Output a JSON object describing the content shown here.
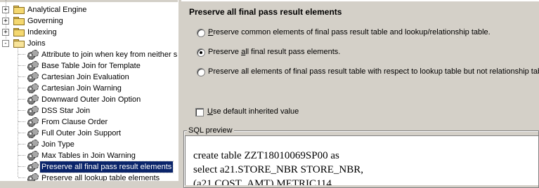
{
  "tree": {
    "items": [
      {
        "label": "Analytical Engine",
        "type": "folder",
        "expander": "+"
      },
      {
        "label": "Governing",
        "type": "folder",
        "expander": "+"
      },
      {
        "label": "Indexing",
        "type": "folder",
        "expander": "+"
      },
      {
        "label": "Joins",
        "type": "folder-open",
        "expander": "-"
      },
      {
        "label": "Attribute to join when key from neither s",
        "type": "setting"
      },
      {
        "label": "Base Table Join for Template",
        "type": "setting"
      },
      {
        "label": "Cartesian Join Evaluation",
        "type": "setting"
      },
      {
        "label": "Cartesian Join Warning",
        "type": "setting"
      },
      {
        "label": "Downward Outer Join Option",
        "type": "setting"
      },
      {
        "label": "DSS Star Join",
        "type": "setting"
      },
      {
        "label": "From Clause Order",
        "type": "setting"
      },
      {
        "label": "Full Outer Join Support",
        "type": "setting"
      },
      {
        "label": "Join Type",
        "type": "setting"
      },
      {
        "label": "Max Tables in Join Warning",
        "type": "setting"
      },
      {
        "label": "Preserve all final pass result elements",
        "type": "setting",
        "selected": true
      },
      {
        "label": "Preserve all lookup table elements",
        "type": "setting"
      }
    ]
  },
  "panel": {
    "title": "Preserve all final pass result elements",
    "options": [
      {
        "underline": "P",
        "rest": "reserve common elements of final pass result table and lookup/relationship table.",
        "selected": false
      },
      {
        "pre": "Preserve ",
        "underline": "a",
        "rest": "ll final result pass elements.",
        "selected": true
      },
      {
        "pre": "Preserve all elements of final pass result table with respect to lookup table but not relationship table.",
        "underline": "",
        "rest": "",
        "selected": false
      }
    ],
    "default_checkbox": {
      "underline": "U",
      "rest": "se default inherited value",
      "checked": false
    }
  },
  "sql": {
    "legend": "SQL preview",
    "lines": [
      "create table ZZT18010069SP00 as",
      "select a21.STORE_NBR  STORE_NBR,",
      "       (a21.COST_AMT)  METRIC114"
    ]
  }
}
